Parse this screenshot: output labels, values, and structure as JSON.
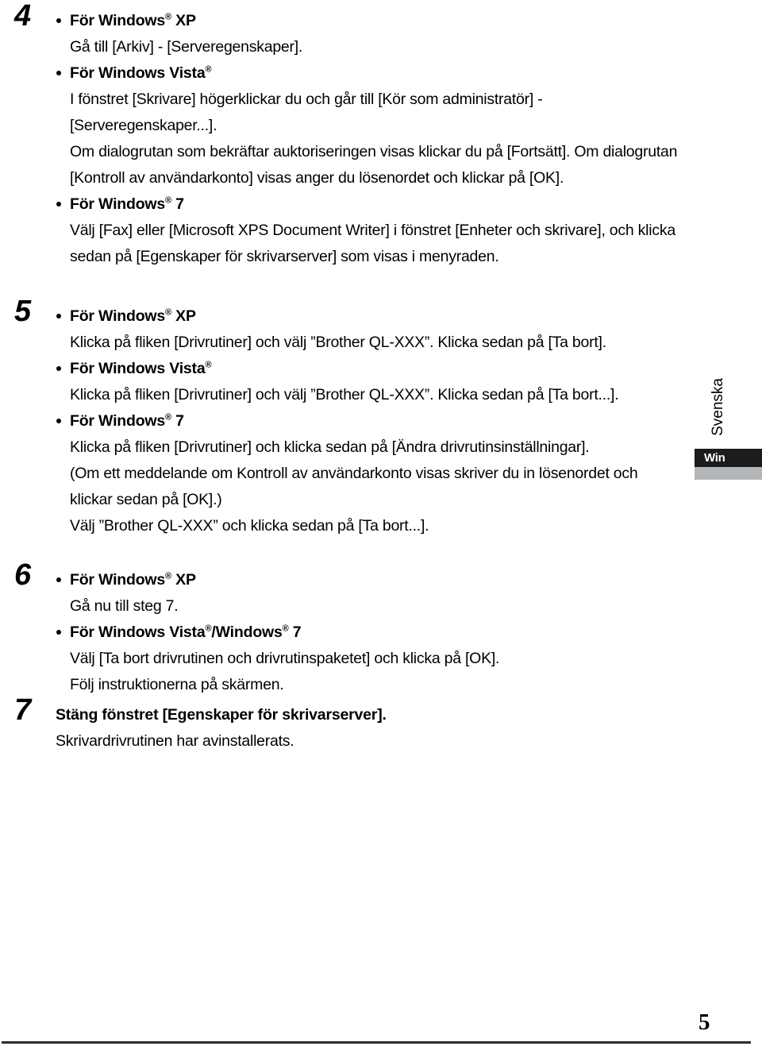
{
  "document": {
    "language_tab": "Svenska",
    "os_tab": "Win",
    "page_number": "5"
  },
  "steps": [
    {
      "number": "4",
      "blocks": [
        {
          "heading_pre": "För Windows",
          "heading_reg": "®",
          "heading_post": " XP",
          "lines": [
            "Gå till [Arkiv] - [Serveregenskaper]."
          ]
        },
        {
          "heading_pre": "För Windows Vista",
          "heading_reg": "®",
          "heading_post": "",
          "lines": [
            "I fönstret [Skrivare] högerklickar du och går till [Kör som administratör] - [Serveregenskaper...].",
            "Om dialogrutan som bekräftar auktoriseringen visas klickar du på [Fortsätt]. Om dialogrutan [Kontroll av användarkonto] visas anger du lösenordet och klickar på [OK]."
          ]
        },
        {
          "heading_pre": "För Windows",
          "heading_reg": "®",
          "heading_post": " 7",
          "lines": [
            "Välj [Fax] eller [Microsoft XPS Document Writer] i fönstret [Enheter och skrivare], och klicka sedan på [Egenskaper för skrivarserver] som visas i menyraden."
          ]
        }
      ]
    },
    {
      "number": "5",
      "blocks": [
        {
          "heading_pre": "För Windows",
          "heading_reg": "®",
          "heading_post": " XP",
          "lines": [
            "Klicka på fliken [Drivrutiner] och välj ”Brother QL-XXX”. Klicka sedan på [Ta bort]."
          ]
        },
        {
          "heading_pre": "För Windows Vista",
          "heading_reg": "®",
          "heading_post": "",
          "lines": [
            "Klicka på fliken [Drivrutiner] och välj ”Brother QL-XXX”. Klicka sedan på [Ta bort...]."
          ]
        },
        {
          "heading_pre": "För Windows",
          "heading_reg": "®",
          "heading_post": " 7",
          "lines": [
            "Klicka på fliken [Drivrutiner] och klicka sedan på [Ändra drivrutinsinställningar].",
            "(Om ett meddelande om Kontroll av användarkonto visas skriver du in lösenordet och klickar sedan på [OK].)",
            "Välj ”Brother QL-XXX” och klicka sedan på [Ta bort...]."
          ]
        }
      ]
    },
    {
      "number": "6",
      "blocks": [
        {
          "heading_pre": "För Windows",
          "heading_reg": "®",
          "heading_post": " XP",
          "lines": [
            "Gå nu till steg 7."
          ]
        },
        {
          "heading_pre": "För Windows Vista",
          "heading_reg": "®",
          "heading_mid": "/Windows",
          "heading_reg2": "®",
          "heading_post": " 7",
          "lines": [
            "Välj [Ta bort drivrutinen och drivrutinspaketet] och klicka på [OK].",
            "Följ instruktionerna på skärmen."
          ]
        }
      ]
    },
    {
      "number": "7",
      "title": "Stäng fönstret [Egenskaper för skrivarserver].",
      "lines": [
        "Skrivardrivrutinen har avinstallerats."
      ]
    }
  ]
}
